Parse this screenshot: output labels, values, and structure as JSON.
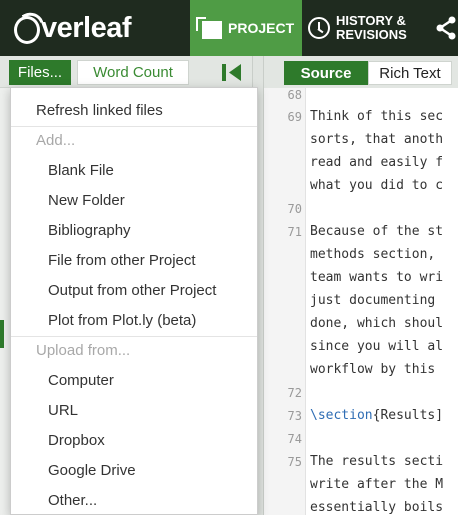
{
  "header": {
    "logo_text": "verleaf",
    "project_tab": "PROJECT",
    "history_tab_line1": "HISTORY &",
    "history_tab_line2": "REVISIONS"
  },
  "tree_toolbar": {
    "files_button": "Files...",
    "word_count_button": "Word Count"
  },
  "editor_toolbar": {
    "source_button": "Source",
    "rich_text_button": "Rich Text"
  },
  "files_menu": {
    "refresh": "Refresh linked files",
    "add_header": "Add...",
    "add_items": [
      "Blank File",
      "New Folder",
      "Bibliography",
      "File from other Project",
      "Output from other Project",
      "Plot from Plot.ly (beta)"
    ],
    "upload_header": "Upload from...",
    "upload_items": [
      "Computer",
      "URL",
      "Dropbox",
      "Google Drive",
      "Other..."
    ]
  },
  "editor": {
    "line_numbers": [
      "68",
      "69",
      "70",
      "71",
      "72",
      "73",
      "74",
      "75"
    ],
    "lines": [
      "Think of this sec",
      "sorts, that anoth",
      "read and easily f",
      "what you did to c",
      "Because of the st",
      "methods section, ",
      "team wants to wri",
      "just documenting ",
      "done, which shoul",
      "since you will al",
      "workflow by this ",
      "The results secti",
      "write after the M",
      "essentially boils"
    ],
    "section_cmd": "\\section",
    "section_arg": "{Results]"
  },
  "colors": {
    "header_bg": "#1f2b1f",
    "accent_green": "#4f9c45",
    "button_green": "#2e7a2b"
  }
}
